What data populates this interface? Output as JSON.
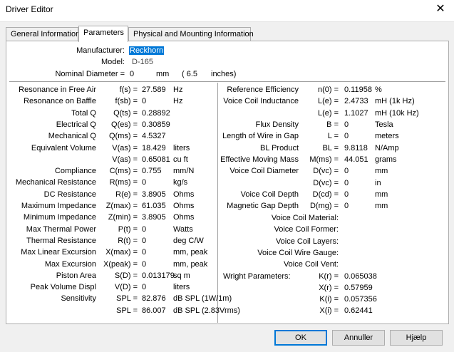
{
  "window": {
    "title": "Driver Editor",
    "close_glyph": "✕"
  },
  "tabs": [
    {
      "label": "General Information"
    },
    {
      "label": "Parameters"
    },
    {
      "label": "Physical and Mounting Information"
    }
  ],
  "header": {
    "manufacturer_label": "Manufacturer:",
    "manufacturer_value": "Reckhorn",
    "model_label": "Model:",
    "model_value": "D-165",
    "diameter_label": "Nominal Diameter =",
    "diameter_value": "0",
    "diameter_unit": "mm",
    "diameter_inches": "(  6.5",
    "diameter_inches_unit": "inches)"
  },
  "left": [
    {
      "name": "Resonance in Free Air",
      "sym": "f(s) =",
      "val": "27.589",
      "unit": "Hz"
    },
    {
      "name": "Resonance on Baffle",
      "sym": "f(sb) =",
      "val": "0",
      "unit": "Hz"
    },
    {
      "name": "Total Q",
      "sym": "Q(ts) =",
      "val": "0.28892",
      "unit": ""
    },
    {
      "name": "Electrical Q",
      "sym": "Q(es) =",
      "val": "0.30859",
      "unit": ""
    },
    {
      "name": "Mechanical Q",
      "sym": "Q(ms) =",
      "val": "4.5327",
      "unit": ""
    },
    {
      "name": "Equivalent Volume",
      "sym": "V(as) =",
      "val": "18.429",
      "unit": "liters"
    },
    {
      "name": "",
      "sym": "V(as) =",
      "val": "0.65081",
      "unit": "cu ft"
    },
    {
      "name": "Compliance",
      "sym": "C(ms) =",
      "val": "0.755",
      "unit": "mm/N"
    },
    {
      "name": "Mechanical Resistance",
      "sym": "R(ms) =",
      "val": "0",
      "unit": "kg/s"
    },
    {
      "name": "DC Resistance",
      "sym": "R(e) =",
      "val": "3.8905",
      "unit": "Ohms"
    },
    {
      "name": "Maximum Impedance",
      "sym": "Z(max) =",
      "val": "61.035",
      "unit": "Ohms"
    },
    {
      "name": "Minimum Impedance",
      "sym": "Z(min) =",
      "val": "3.8905",
      "unit": "Ohms"
    },
    {
      "name": "Max Thermal Power",
      "sym": "P(t) =",
      "val": "0",
      "unit": "Watts"
    },
    {
      "name": "Thermal Resistance",
      "sym": "R(t) =",
      "val": "0",
      "unit": "deg C/W"
    },
    {
      "name": "Max Linear Excursion",
      "sym": "X(max) =",
      "val": "0",
      "unit": "mm, peak"
    },
    {
      "name": "Max Excursion",
      "sym": "X(peak) =",
      "val": "0",
      "unit": "mm, peak"
    },
    {
      "name": "Piston Area",
      "sym": "S(D) =",
      "val": "0.013179",
      "unit": "sq m"
    },
    {
      "name": "Peak Volume Displ",
      "sym": "V(D) =",
      "val": "0",
      "unit": "liters"
    },
    {
      "name": "Sensitivity",
      "sym": "SPL =",
      "val": "82.876",
      "unit": "dB SPL (1W/1m)"
    },
    {
      "name": "",
      "sym": "SPL =",
      "val": "86.007",
      "unit": "dB SPL (2.83Vrms)"
    }
  ],
  "right": [
    {
      "name": "Reference Efficiency",
      "sym": "n(0) =",
      "val": "0.11958",
      "unit": "%"
    },
    {
      "name": "Voice Coil Inductance",
      "sym": "L(e) =",
      "val": "2.4733",
      "unit": "mH (1k Hz)"
    },
    {
      "name": "",
      "sym": "L(e) =",
      "val": "1.1027",
      "unit": "mH (10k Hz)"
    },
    {
      "name": "Flux Density",
      "sym": "B =",
      "val": "0",
      "unit": "Tesla"
    },
    {
      "name": "Length of Wire in Gap",
      "sym": "L =",
      "val": "0",
      "unit": "meters"
    },
    {
      "name": "BL Product",
      "sym": "BL =",
      "val": "9.8118",
      "unit": "N/Amp"
    },
    {
      "name": "Effective Moving Mass",
      "sym": "M(ms) =",
      "val": "44.051",
      "unit": "grams"
    },
    {
      "name": "Voice Coil Diameter",
      "sym": "D(vc) =",
      "val": "0",
      "unit": "mm"
    },
    {
      "name": "",
      "sym": "D(vc) =",
      "val": "0",
      "unit": "in"
    },
    {
      "name": "Voice Coil Depth",
      "sym": "D(cd) =",
      "val": "0",
      "unit": "mm"
    },
    {
      "name": "Magnetic Gap Depth",
      "sym": "D(mg) =",
      "val": "0",
      "unit": "mm"
    }
  ],
  "right_text": [
    "Voice Coil Material:",
    "Voice Coil Former:",
    "Voice Coil Layers:",
    "Voice Coil Wire Gauge:",
    "Voice Coil Vent:"
  ],
  "wright": {
    "label": "Wright Parameters:",
    "rows": [
      {
        "sym": "K(r) =",
        "val": "0.065038"
      },
      {
        "sym": "X(r) =",
        "val": "0.57959"
      },
      {
        "sym": "K(i) =",
        "val": "0.057356"
      },
      {
        "sym": "X(i) =",
        "val": "0.62441"
      }
    ]
  },
  "buttons": {
    "ok": "OK",
    "cancel": "Annuller",
    "help": "Hjælp"
  }
}
